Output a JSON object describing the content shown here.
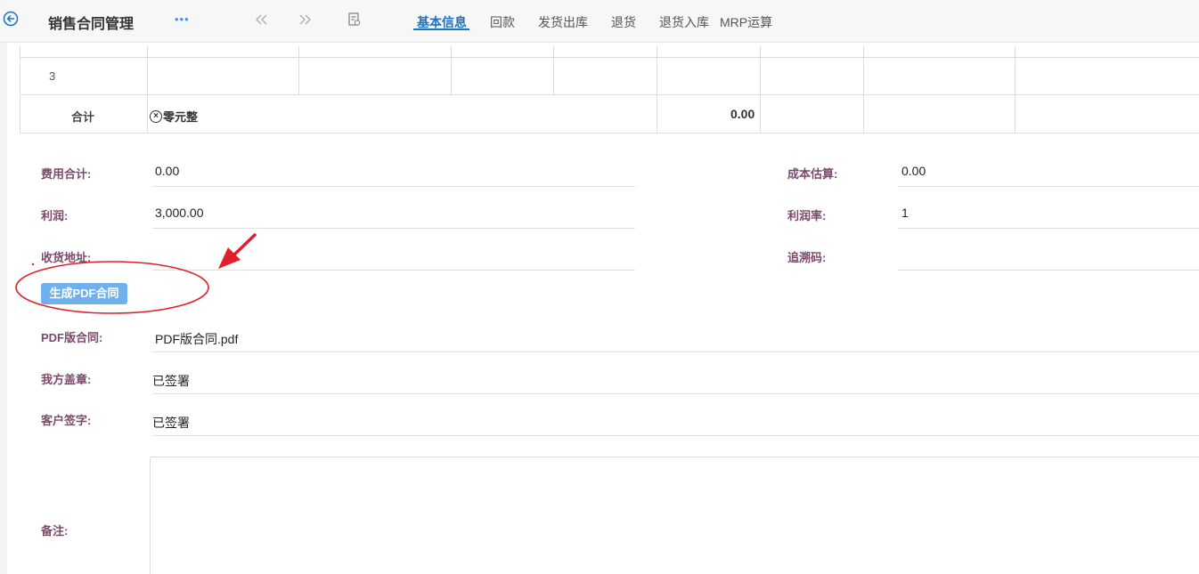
{
  "header": {
    "title": "销售合同管理",
    "more": "•••",
    "tabs": [
      {
        "label": "基本信息",
        "active": true
      },
      {
        "label": "回款"
      },
      {
        "label": "发货出库"
      },
      {
        "label": "退货"
      },
      {
        "label": "退货入库"
      },
      {
        "label": "MRP运算"
      }
    ]
  },
  "table": {
    "row_number": "3",
    "summary_label": "合计",
    "summary_upper_symbol": "×",
    "summary_upper": "零元整",
    "summary_amount": "0.00"
  },
  "form": {
    "fee_total_label": "费用合计:",
    "fee_total_value": "0.00",
    "cost_estimate_label": "成本估算:",
    "cost_estimate_value": "0.00",
    "profit_label": "利润:",
    "profit_value": "3,000.00",
    "profit_rate_label": "利润率:",
    "profit_rate_value": "1",
    "address_label": "收货地址:",
    "trace_code_label": "追溯码:",
    "generate_pdf_button": "生成PDF合同",
    "pdf_contract_label": "PDF版合同:",
    "pdf_contract_value": "PDF版合同.pdf",
    "our_seal_label": "我方盖章:",
    "our_seal_value": "已签署",
    "customer_sign_label": "客户签字:",
    "customer_sign_value": "已签署",
    "remark_label": "备注:"
  },
  "colors": {
    "accent": "#1a73c7",
    "label": "#7b4a6b",
    "button": "#6fb1ec",
    "annotation": "#e0202a"
  },
  "icons": [
    "back-circle-icon",
    "more-icon",
    "prev-icon",
    "next-icon",
    "document-icon",
    "red-arrow-icon"
  ]
}
